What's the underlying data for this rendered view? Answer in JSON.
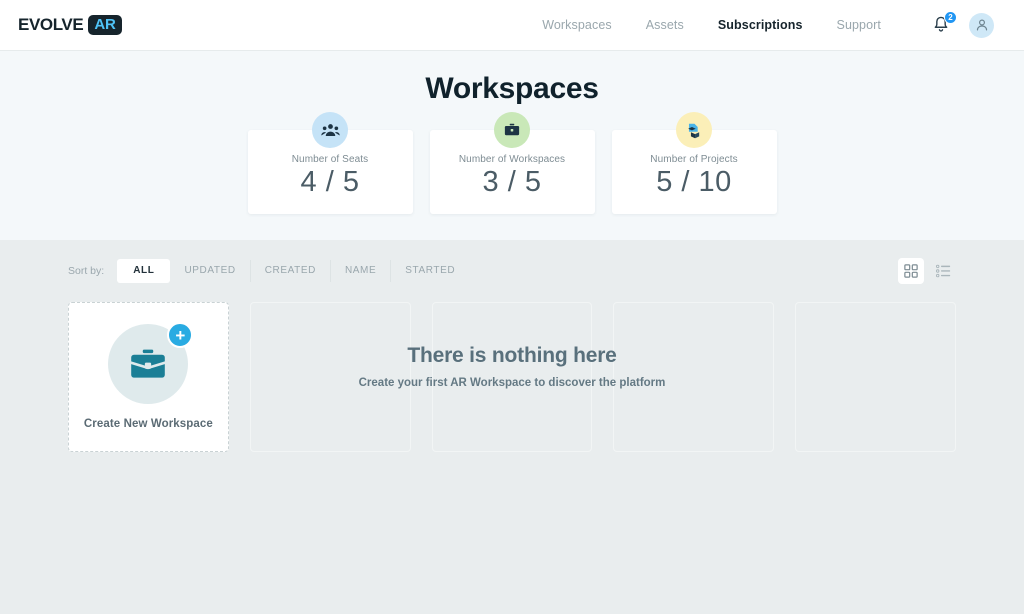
{
  "brand": {
    "word": "EVOLVE",
    "badge": "AR"
  },
  "nav": {
    "items": [
      {
        "label": "Workspaces",
        "active": false
      },
      {
        "label": "Assets",
        "active": false
      },
      {
        "label": "Subscriptions",
        "active": true
      },
      {
        "label": "Support",
        "active": false
      }
    ],
    "notification_count": "2",
    "icons": {
      "bell": "bell-icon",
      "avatar": "user-avatar-icon"
    }
  },
  "hero": {
    "title": "Workspaces",
    "stats": [
      {
        "label": "Number of Seats",
        "value": "4 / 5",
        "icon": "people-group-icon",
        "icon_bg": "#c5e3f7"
      },
      {
        "label": "Number of Workspaces",
        "value": "3 / 5",
        "icon": "briefcase-icon",
        "icon_bg": "#c9e8b8"
      },
      {
        "label": "Number of Projects",
        "value": "5 / 10",
        "icon": "project-cube-icon",
        "icon_bg": "#fbefb8"
      }
    ]
  },
  "toolbar": {
    "sort_label": "Sort by:",
    "sort_options": [
      {
        "label": "ALL",
        "active": true
      },
      {
        "label": "UPDATED",
        "active": false
      },
      {
        "label": "CREATED",
        "active": false
      },
      {
        "label": "NAME",
        "active": false
      },
      {
        "label": "STARTED",
        "active": false
      }
    ],
    "views": [
      {
        "name": "grid-view-icon",
        "active": true
      },
      {
        "name": "list-view-icon",
        "active": false
      }
    ]
  },
  "grid": {
    "create_card": {
      "label": "Create New Workspace",
      "icon": "briefcase-icon",
      "badge": "+"
    },
    "placeholder_count": 4,
    "empty_state": {
      "title": "There is nothing here",
      "subtitle": "Create your first AR Workspace to discover the platform"
    }
  },
  "colors": {
    "accent_blue": "#29abe2",
    "dark_navy": "#16242c",
    "hero_bg": "#f4f8fa",
    "body_bg": "#e9edee",
    "teal_icon": "#1b7f96"
  }
}
